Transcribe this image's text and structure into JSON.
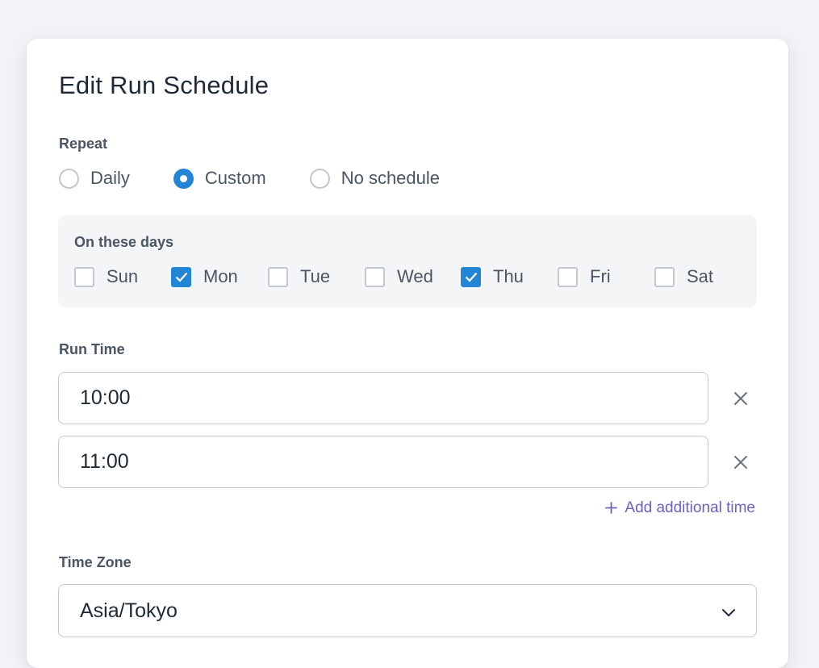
{
  "dialog": {
    "title": "Edit Run Schedule"
  },
  "repeat": {
    "label": "Repeat",
    "options": [
      {
        "label": "Daily",
        "selected": false
      },
      {
        "label": "Custom",
        "selected": true
      },
      {
        "label": "No schedule",
        "selected": false
      }
    ]
  },
  "days": {
    "label": "On these days",
    "items": [
      {
        "label": "Sun",
        "checked": false
      },
      {
        "label": "Mon",
        "checked": true
      },
      {
        "label": "Tue",
        "checked": false
      },
      {
        "label": "Wed",
        "checked": false
      },
      {
        "label": "Thu",
        "checked": true
      },
      {
        "label": "Fri",
        "checked": false
      },
      {
        "label": "Sat",
        "checked": false
      }
    ]
  },
  "run_time": {
    "label": "Run Time",
    "times": [
      "10:00",
      "11:00"
    ],
    "add_label": "Add additional time",
    "add_icon": "plus-icon",
    "remove_icon": "close-icon"
  },
  "time_zone": {
    "label": "Time Zone",
    "selected": "Asia/Tokyo",
    "dropdown_icon": "chevron-down-icon"
  },
  "colors": {
    "accent": "#2385d6",
    "link": "#6b5fc7"
  }
}
